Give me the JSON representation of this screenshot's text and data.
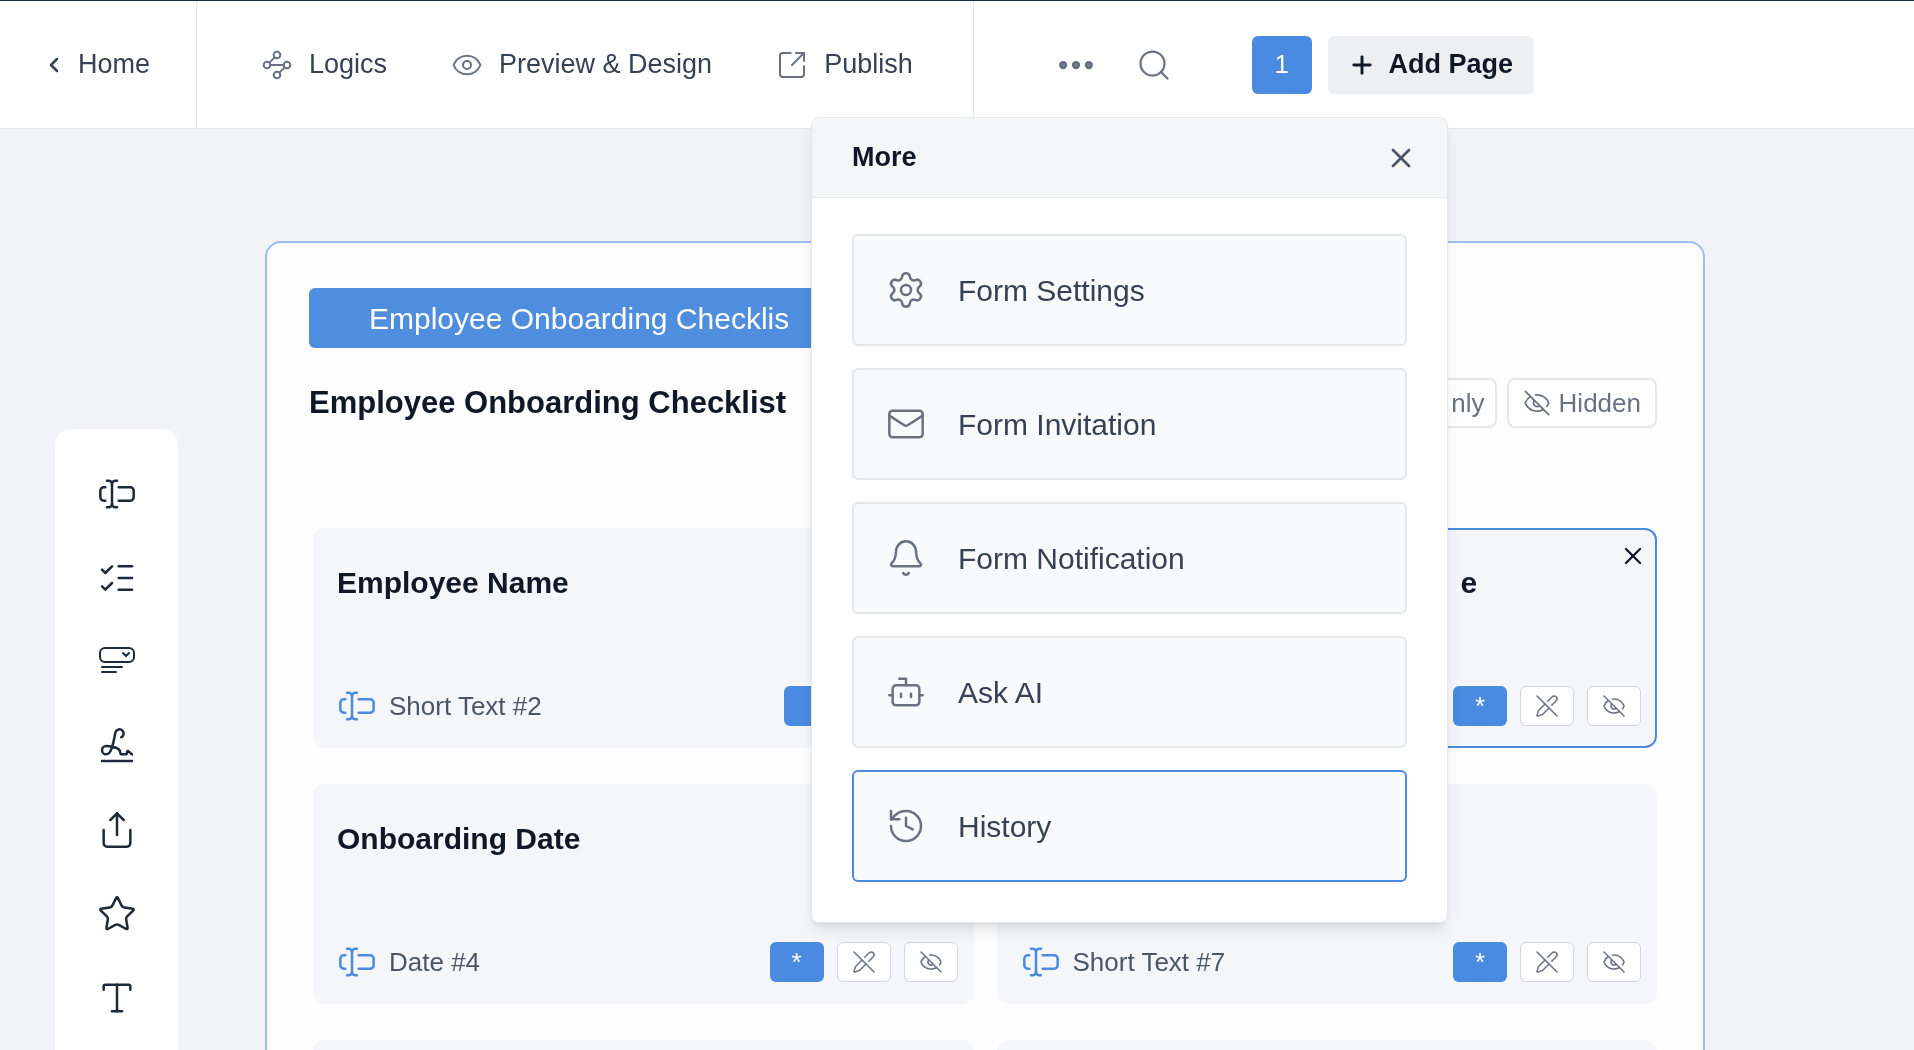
{
  "topbar": {
    "home": "Home",
    "nav": [
      {
        "label": "Logics",
        "kind": "logics"
      },
      {
        "label": "Preview & Design",
        "kind": "preview"
      },
      {
        "label": "Publish",
        "kind": "publish"
      }
    ],
    "page_number": "1",
    "add_page": "Add Page"
  },
  "toolbar": [
    {
      "kind": "short-text"
    },
    {
      "kind": "checklist"
    },
    {
      "kind": "dropdown"
    },
    {
      "kind": "signature"
    },
    {
      "kind": "upload"
    },
    {
      "kind": "rating"
    },
    {
      "kind": "text"
    }
  ],
  "form": {
    "title_bar": "Employee Onboarding Checklis",
    "heading": "Employee Onboarding Checklist",
    "pills": [
      {
        "label": "nly",
        "kind": "plain"
      },
      {
        "label": "Hidden",
        "kind": "hidden"
      }
    ],
    "fields": [
      {
        "title": "Employee Name",
        "label": "Short Text #2",
        "required": true,
        "tools": false,
        "selected": false
      },
      {
        "title": "e",
        "required": true,
        "button_text": "*",
        "tools": true,
        "selected": true
      },
      {
        "title": "Onboarding Date",
        "label": "Date #4",
        "required": true,
        "button_text": "*",
        "tools": true,
        "selected": false
      },
      {
        "label": "Short Text #7",
        "required": true,
        "button_text": "*",
        "tools": true,
        "selected": false
      }
    ]
  },
  "more_menu": {
    "title": "More",
    "items": [
      {
        "label": "Form Settings",
        "kind": "settings",
        "selected": false
      },
      {
        "label": "Form Invitation",
        "kind": "invitation",
        "selected": false
      },
      {
        "label": "Form Notification",
        "kind": "notification",
        "selected": false
      },
      {
        "label": "Ask AI",
        "kind": "ai",
        "selected": false
      },
      {
        "label": "History",
        "kind": "history",
        "selected": true
      }
    ]
  }
}
